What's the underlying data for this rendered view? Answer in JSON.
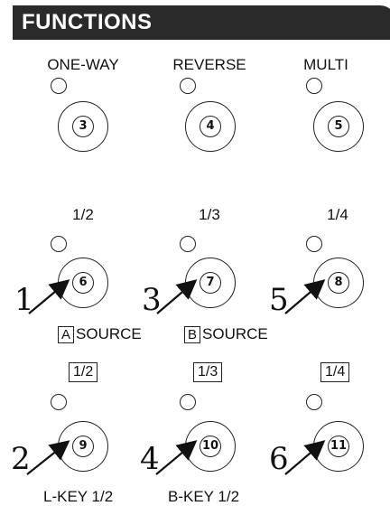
{
  "header": {
    "title": "FUNCTIONS"
  },
  "row1": {
    "labels": [
      "ONE-WAY",
      "REVERSE",
      "MULTI"
    ],
    "buttons": [
      "3",
      "4",
      "5"
    ]
  },
  "row2": {
    "labels": [
      "1/2",
      "1/3",
      "1/4"
    ],
    "buttons": [
      "6",
      "7",
      "8"
    ],
    "numbers": [
      "1",
      "3",
      "5"
    ]
  },
  "sources": {
    "a_key": "A",
    "a_text": "SOURCE",
    "b_key": "B",
    "b_text": "SOURCE"
  },
  "row3": {
    "labels": [
      "1/2",
      "1/3",
      "1/4"
    ],
    "buttons": [
      "9",
      "10",
      "11"
    ],
    "numbers": [
      "2",
      "4",
      "6"
    ]
  },
  "footer": {
    "lkey": "L-KEY 1/2",
    "bkey": "B-KEY 1/2"
  }
}
